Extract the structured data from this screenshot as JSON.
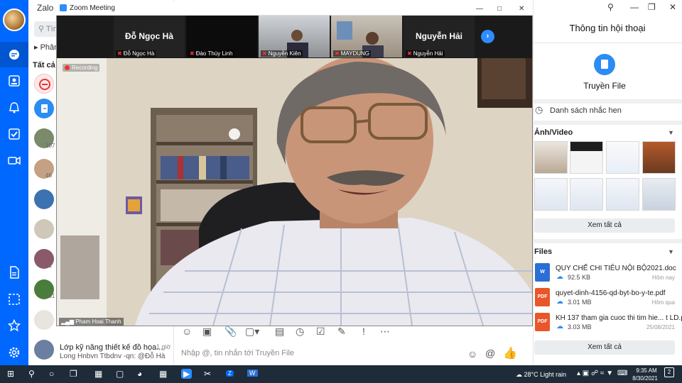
{
  "zalo": {
    "app_title": "Zalo - Đ",
    "search_placeholder": "Tìn",
    "filter_label": "Phân",
    "all_tab": "Tất cả ti",
    "conv_badges": [
      "107",
      "46",
      "71",
      "101"
    ],
    "last_conv": {
      "title": "Lớp kỹ năng thiết kế đồ họa...",
      "subtitle": "Long Hnbvn Ttbdnv -qn: @Đỗ Hà",
      "time": "1 giờ"
    },
    "chat_input_placeholder": "Nhập @, tin nhắn tới Truyền File"
  },
  "zoom": {
    "window_title": "Zoom Meeting",
    "recording_label": "Recording",
    "speaker_name": "Pham Hoai Thanh",
    "participants": [
      {
        "big_name": "Đỗ Ngọc Hà",
        "label": "Đỗ Ngọc Hà"
      },
      {
        "big_name": "",
        "label": "Đào Thùy Linh"
      },
      {
        "big_name": "",
        "label": "Nguyễn Kiên"
      },
      {
        "big_name": "",
        "label": "MAYDUNG"
      },
      {
        "big_name": "Nguyễn Hải",
        "label": "Nguyễn Hải"
      }
    ]
  },
  "info_panel": {
    "title": "Thông tin hội thoại",
    "name": "Truyền File",
    "reminder_label": "Danh sách nhắc hen",
    "media_title": "Ảnh/Video",
    "see_all": "Xem tất cả",
    "files_title": "Files",
    "files": [
      {
        "name": "QUY CHẾ CHI TIÊU NỘI BỘ2021.doc",
        "size": "92.5 KB",
        "date": "Hôm nay",
        "type": "W",
        "color": "#2b6fd6"
      },
      {
        "name": "quyet-dinh-4156-qd-byt-bo-y-te.pdf",
        "size": "3.01 MB",
        "date": "Hôm qua",
        "type": "PDF",
        "color": "#e8562a"
      },
      {
        "name": "KH 137 tham gia cuoc thi tim hie... t LD.pdf",
        "size": "3.03 MB",
        "date": "25/08/2021",
        "type": "PDF",
        "color": "#e8562a"
      }
    ]
  },
  "taskbar": {
    "weather": "28°C  Light rain",
    "time": "9:35 AM",
    "date": "8/30/2021",
    "notif_count": "2"
  },
  "colors": {
    "zalo_blue": "#0068ff",
    "zoom_blue": "#2d8cff",
    "taskbar": "#1e2b38"
  }
}
